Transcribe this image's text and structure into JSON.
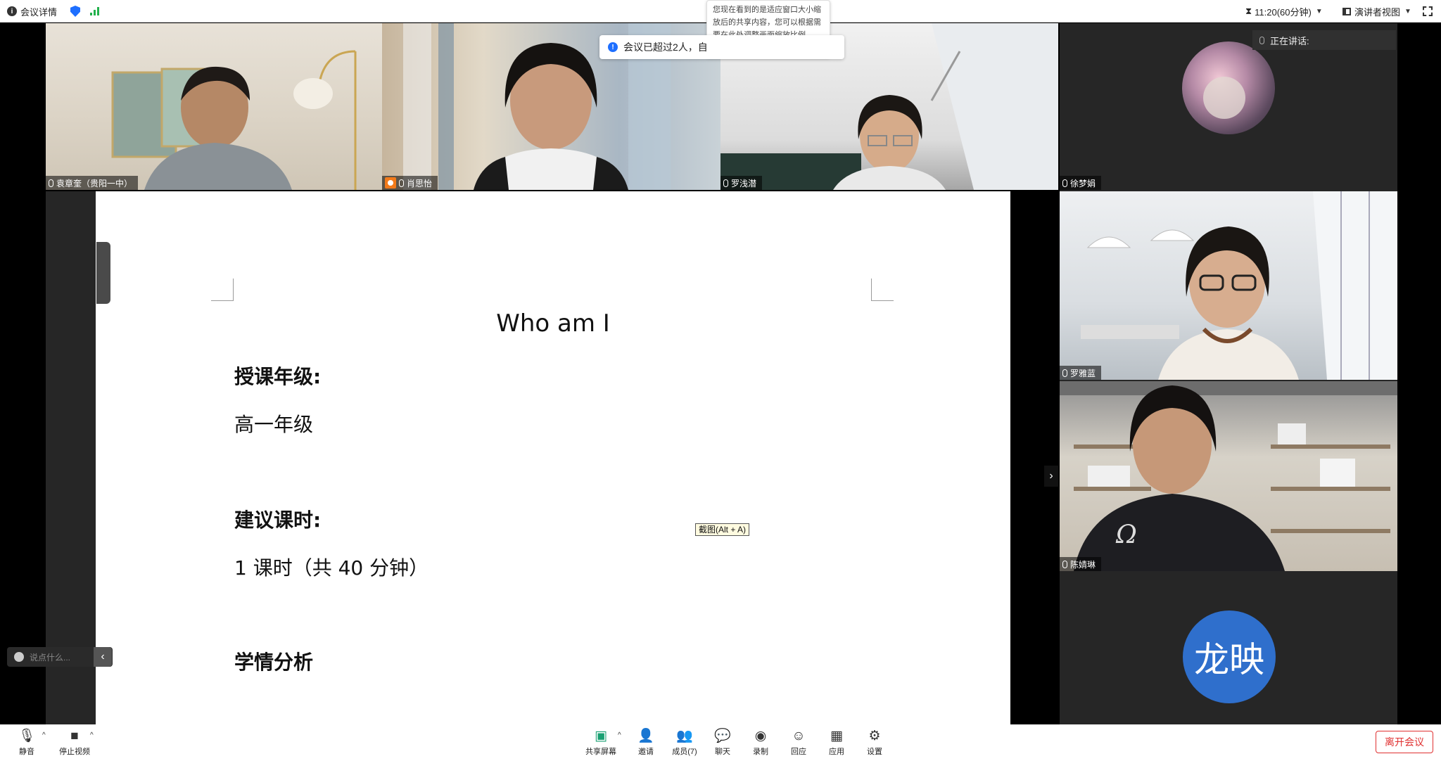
{
  "topbar": {
    "meeting_details": "会议详情",
    "timer": "11:20(60分钟)",
    "view_mode": "演讲者视图"
  },
  "tooltip_zoom": "您现在看到的是适应窗口大小缩放后的共享内容，您可以根据需要在此处调整画面缩放比例",
  "notice": "会议已超过2人，自",
  "speaking": {
    "label": "正在讲话:"
  },
  "participants": [
    {
      "name": "袁章奎（贵阳一中）"
    },
    {
      "name": "肖思怡"
    },
    {
      "name": "罗浅潜"
    },
    {
      "name": "徐梦娟"
    },
    {
      "name": "罗雅蓝"
    },
    {
      "name": "陈婧琳"
    },
    {
      "name": "龙映"
    }
  ],
  "avatar_text": "龙映",
  "slide": {
    "title": "Who am I",
    "h1": "授课年级:",
    "p1": "高一年级",
    "h2": "建议课时:",
    "p2": "1 课时（共 40 分钟）",
    "h3": "学情分析"
  },
  "screenshot_hint": "截图(Alt + A)",
  "chat_input": {
    "placeholder": "说点什么..."
  },
  "toolbar": {
    "mute": "静音",
    "stop_video": "停止视频",
    "share_screen": "共享屏幕",
    "invite": "邀请",
    "members": "成员(7)",
    "chat": "聊天",
    "record": "录制",
    "react": "回应",
    "apps": "应用",
    "settings": "设置",
    "leave": "离开会议"
  },
  "colors": {
    "accent_blue": "#1e6fff",
    "signal_green": "#22b14c",
    "leave_red": "#e03131",
    "avatar_blue": "#2f6fcc",
    "host_orange": "#f27a1a"
  }
}
